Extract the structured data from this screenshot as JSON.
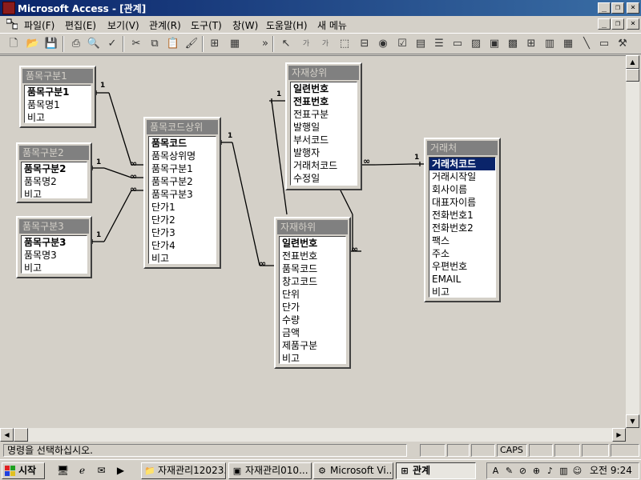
{
  "window": {
    "title": "Microsoft Access - [관계]"
  },
  "menu": [
    "파일(F)",
    "편집(E)",
    "보기(V)",
    "관계(R)",
    "도구(T)",
    "창(W)",
    "도움말(H)",
    "새 메뉴"
  ],
  "tables": [
    {
      "title": "품목구분1",
      "fields": [
        {
          "name": "품목구분1",
          "pk": true
        },
        {
          "name": "품목명1"
        },
        {
          "name": "비고"
        }
      ]
    },
    {
      "title": "품목구분2",
      "fields": [
        {
          "name": "품목구분2",
          "pk": true
        },
        {
          "name": "품목명2"
        },
        {
          "name": "비고"
        }
      ]
    },
    {
      "title": "품목구분3",
      "fields": [
        {
          "name": "품목구분3",
          "pk": true
        },
        {
          "name": "품목명3"
        },
        {
          "name": "비고"
        }
      ]
    },
    {
      "title": "품목코드상위",
      "fields": [
        {
          "name": "품목코드",
          "pk": true
        },
        {
          "name": "품목상위명"
        },
        {
          "name": "품목구분1"
        },
        {
          "name": "품목구분2"
        },
        {
          "name": "품목구분3"
        },
        {
          "name": "단가1"
        },
        {
          "name": "단가2"
        },
        {
          "name": "단가3"
        },
        {
          "name": "단가4"
        },
        {
          "name": "비고"
        }
      ]
    },
    {
      "title": "자재상위",
      "fields": [
        {
          "name": "일련번호",
          "pk": true
        },
        {
          "name": "전표번호",
          "pk": true
        },
        {
          "name": "전표구분"
        },
        {
          "name": "발행일"
        },
        {
          "name": "부서코드"
        },
        {
          "name": "발행자"
        },
        {
          "name": "거래처코드"
        },
        {
          "name": "수정일"
        }
      ]
    },
    {
      "title": "자재하위",
      "fields": [
        {
          "name": "일련번호",
          "pk": true
        },
        {
          "name": "전표번호"
        },
        {
          "name": "품목코드"
        },
        {
          "name": "창고코드"
        },
        {
          "name": "단위"
        },
        {
          "name": "단가"
        },
        {
          "name": "수량"
        },
        {
          "name": "금액"
        },
        {
          "name": "제품구분"
        },
        {
          "name": "비고"
        }
      ]
    },
    {
      "title": "거래처",
      "fields": [
        {
          "name": "거래처코드",
          "pk": true,
          "selected": true
        },
        {
          "name": "거래시작일"
        },
        {
          "name": "회사이름"
        },
        {
          "name": "대표자이름"
        },
        {
          "name": "전화번호1"
        },
        {
          "name": "전화번호2"
        },
        {
          "name": "팩스"
        },
        {
          "name": "주소"
        },
        {
          "name": "우편번호"
        },
        {
          "name": "EMAIL"
        },
        {
          "name": "비고"
        }
      ]
    }
  ],
  "relationship_labels": {
    "one": "1",
    "many": "∞"
  },
  "status": {
    "message": "명령을 선택하십시오.",
    "caps": "CAPS"
  },
  "taskbar": {
    "start": "시작",
    "tasks": [
      "자재관리12023...",
      "자재관리010...",
      "Microsoft Vi...",
      "관계"
    ],
    "clock": "오전 9:24"
  },
  "colors": {
    "title_active": "#0a246a",
    "title_inactive": "#808080",
    "selection": "#0a246a"
  }
}
